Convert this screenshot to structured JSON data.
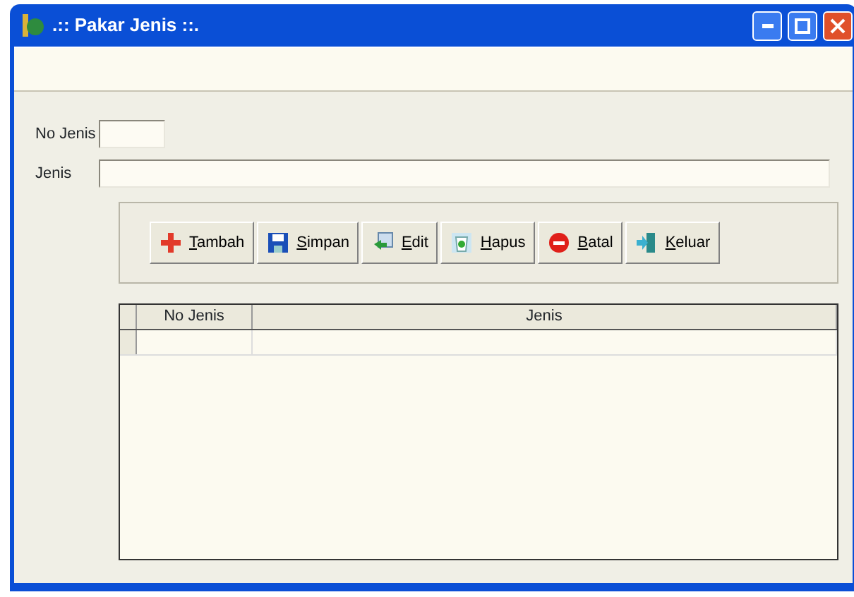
{
  "window": {
    "title": ".:: Pakar Jenis ::."
  },
  "form": {
    "fields": [
      {
        "label": "No Jenis"
      },
      {
        "label": "Jenis"
      }
    ]
  },
  "buttons": [
    {
      "label": "Tambah"
    },
    {
      "label": "Simpan"
    },
    {
      "label": "Edit"
    },
    {
      "label": "Hapus"
    },
    {
      "label": "Batal"
    },
    {
      "label": "Keluar"
    }
  ],
  "table": {
    "columns": [
      "No Jenis",
      "Jenis"
    ]
  }
}
